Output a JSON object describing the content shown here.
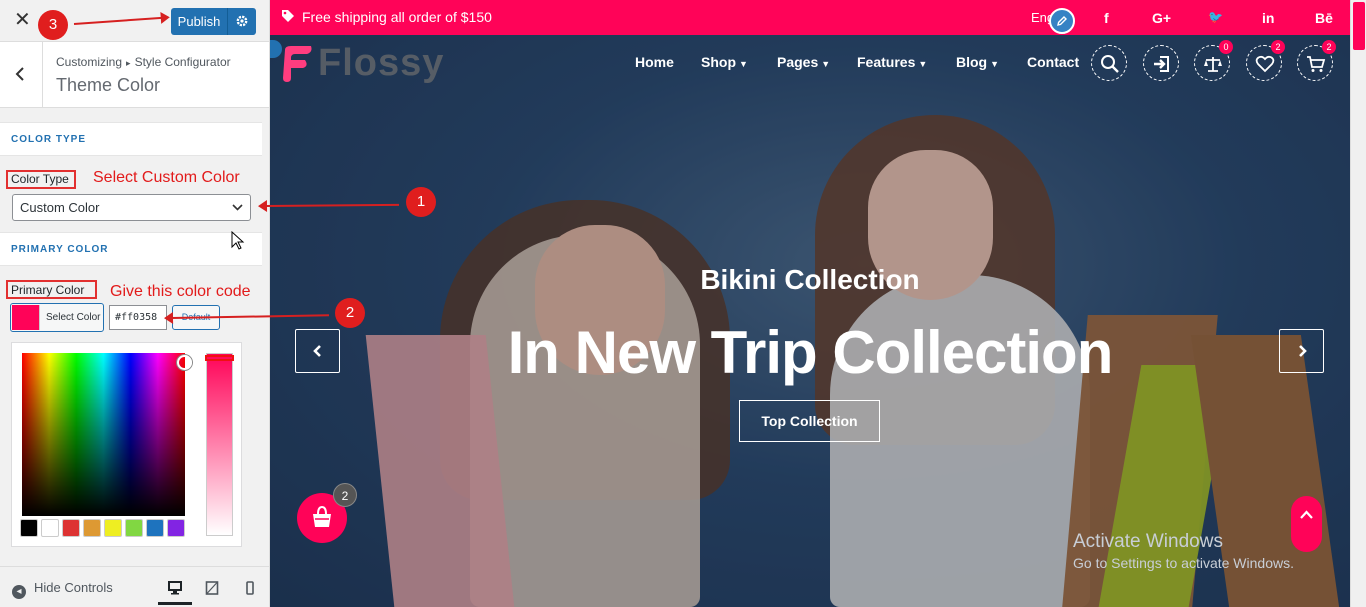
{
  "customizer": {
    "close_icon": "close-icon",
    "publish_label": "Publish",
    "gear_icon": "gear-icon",
    "breadcrumb_parent": "Customizing",
    "breadcrumb_arrow": "▸",
    "breadcrumb_section": "Style Configurator",
    "panel_title": "Theme Color",
    "section_color_type": "COLOR TYPE",
    "color_type_label": "Color Type",
    "color_type_value": "Custom Color",
    "section_primary_color": "PRIMARY COLOR",
    "primary_color_label": "Primary Color",
    "select_color_label": "Select Color",
    "hex_value": "#ff0358",
    "default_label": "Default",
    "selected_color": "#ff0358",
    "palette": [
      "#000000",
      "#ffffff",
      "#dd3333",
      "#dd9933",
      "#eeee22",
      "#81d742",
      "#1e73be",
      "#8224e3"
    ],
    "hide_controls_label": "Hide Controls",
    "devices": [
      "desktop",
      "tablet",
      "mobile"
    ]
  },
  "annotations": {
    "step1": "1",
    "step1_text": "Select Custom Color",
    "step2": "2",
    "step2_text": "Give this color code",
    "step3": "3"
  },
  "site": {
    "topbar_text": "Free shipping all order of $150",
    "language": "Eng",
    "social": [
      "f",
      "G+",
      "🐦",
      "in",
      "Bē"
    ],
    "brand_color": "#ff0358",
    "logo_text": "Flossy",
    "nav": [
      {
        "label": "Home",
        "dropdown": false
      },
      {
        "label": "Shop",
        "dropdown": true
      },
      {
        "label": "Pages",
        "dropdown": true
      },
      {
        "label": "Features",
        "dropdown": true
      },
      {
        "label": "Blog",
        "dropdown": true
      },
      {
        "label": "Contact",
        "dropdown": false
      }
    ],
    "compare_count": "0",
    "wishlist_count": "2",
    "cart_count": "2",
    "hero_subtitle": "Bikini Collection",
    "hero_title": "In New Trip Collection",
    "hero_button": "Top Collection",
    "floating_cart_count": "2",
    "activate_line1": "Activate Windows",
    "activate_line2": "Go to Settings to activate Windows."
  }
}
